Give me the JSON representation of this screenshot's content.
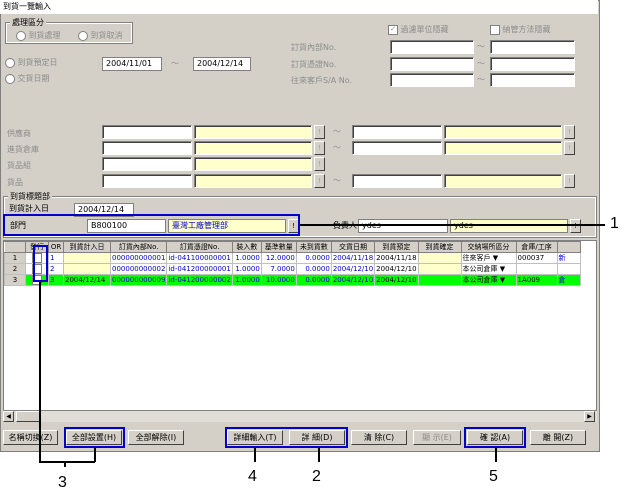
{
  "window": {
    "title": "到貨一覽輸入"
  },
  "process_type": {
    "legend": "處理區分",
    "option1": "到貨處理",
    "option2": "到貨取消"
  },
  "options_right": {
    "check1": "過濾單位隱藏",
    "check2": "納管方法隱藏"
  },
  "date_filter": {
    "radio1": "到貨預定日",
    "radio2": "交貨日期",
    "from": "2004/11/01",
    "tilde": "～",
    "to": "2004/12/14"
  },
  "right_filters": {
    "order_no": "訂貨內部No.",
    "vendor_no": "訂貨憑證No.",
    "customer_no": "往來客戶S/A No."
  },
  "lower_filters": {
    "supplier": "供應商",
    "warehouse": "進貨倉庫",
    "item_group": "貨品組",
    "item": "貨品"
  },
  "tag_section": {
    "legend": "到貨標題部",
    "date_label": "到貨計入日",
    "date_value": "2004/12/14",
    "dept_label": "部門",
    "dept_code": "B800100",
    "dept_name": "臺灣工廠管理部",
    "person_label": "負責人",
    "person_code": "ydes",
    "person_name": "ydes",
    "lookup": "!"
  },
  "grid": {
    "headers": [
      "發行",
      "OR",
      "到貨計入日",
      "訂貨內部No.",
      "訂貨憑證No.",
      "裝入數",
      "基準數量",
      "未到貨數",
      "交貨日期",
      "到貨預定",
      "到貨確定",
      "交納場所區分",
      "倉庫/工序",
      ""
    ],
    "rows": [
      {
        "num": "1",
        "or": "1",
        "date": "",
        "inner": "000000000001",
        "voucher": "id-041100000001",
        "qty_in": "1.0000",
        "base": "12.0000",
        "remain": "0.0000",
        "deliver": "2004/11/18",
        "plan": "2004/11/18",
        "fixed": "",
        "place": "往來客戶",
        "wh": "000037",
        "extra": "新"
      },
      {
        "num": "2",
        "or": "2",
        "date": "",
        "inner": "000000000002",
        "voucher": "id-041200000001",
        "qty_in": "1.0000",
        "base": "7.0000",
        "remain": "0.0000",
        "deliver": "2004/12/10",
        "plan": "2004/12/10",
        "fixed": "",
        "place": "本公司倉庫",
        "wh": "",
        "extra": ""
      },
      {
        "num": "3",
        "or": "3",
        "date": "2004/12/14",
        "inner": "000000000009",
        "voucher": "id-041200000002",
        "qty_in": "1.0000",
        "base": "10.0000",
        "remain": "0.0000",
        "deliver": "2004/12/10",
        "plan": "2004/12/10",
        "fixed": "",
        "place": "本公司倉庫",
        "wh": "1A009",
        "extra": "倉"
      }
    ]
  },
  "buttons": {
    "name_switch": "名稱切換(Z)",
    "select_all": "全部設置(H)",
    "clear_all": "全部解除(I)",
    "detail_input": "詳細輸入(T)",
    "detail": "詳  細(D)",
    "clear": "清  除(C)",
    "display": "顯  示(E)",
    "confirm": "確  認(A)",
    "close": "離  開(Z)"
  },
  "callouts": [
    "1",
    "2",
    "3",
    "4",
    "5"
  ]
}
